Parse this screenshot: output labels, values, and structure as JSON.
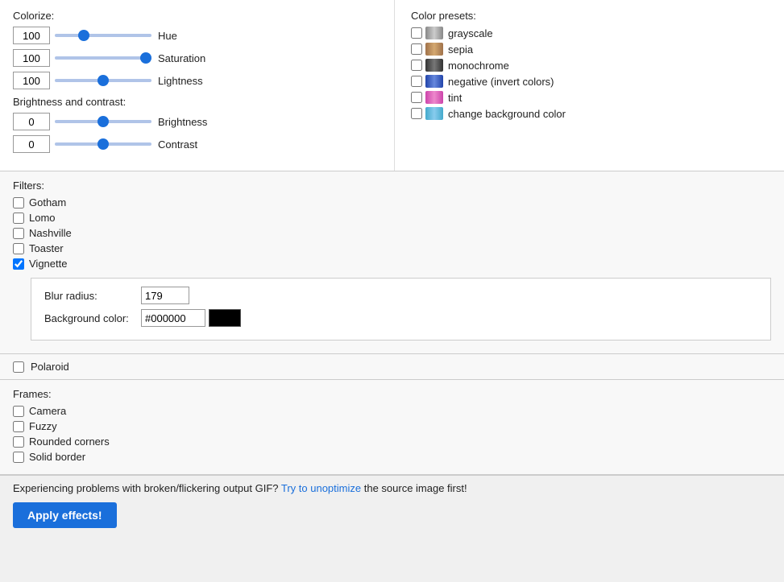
{
  "colorize": {
    "label": "Colorize:",
    "hue": {
      "label": "Hue",
      "value": "100",
      "min": 0,
      "max": 360,
      "current": 100
    },
    "saturation": {
      "label": "Saturation",
      "value": "100",
      "min": 0,
      "max": 100,
      "current": 100
    },
    "lightness": {
      "label": "Lightness",
      "value": "100",
      "min": 0,
      "max": 200,
      "current": 100
    }
  },
  "brightness_contrast": {
    "label": "Brightness and contrast:",
    "brightness": {
      "label": "Brightness",
      "value": "0",
      "min": -100,
      "max": 100,
      "current": 0
    },
    "contrast": {
      "label": "Contrast",
      "value": "0",
      "min": -100,
      "max": 100,
      "current": 0
    }
  },
  "color_presets": {
    "label": "Color presets:",
    "items": [
      {
        "id": "grayscale",
        "label": "grayscale",
        "checked": false,
        "icon_color": "#888"
      },
      {
        "id": "sepia",
        "label": "sepia",
        "checked": false,
        "icon_color": "#a0724a"
      },
      {
        "id": "monochrome",
        "label": "monochrome",
        "checked": false,
        "icon_color": "#555"
      },
      {
        "id": "negative",
        "label": "negative (invert colors)",
        "checked": false,
        "icon_color": "#2244aa"
      },
      {
        "id": "tint",
        "label": "tint",
        "checked": false,
        "icon_color": "#dd66aa"
      },
      {
        "id": "change_bg",
        "label": "change background color",
        "checked": false,
        "icon_color": "#44aacc"
      }
    ]
  },
  "filters": {
    "label": "Filters:",
    "items": [
      {
        "id": "gotham",
        "label": "Gotham",
        "checked": false
      },
      {
        "id": "lomo",
        "label": "Lomo",
        "checked": false
      },
      {
        "id": "nashville",
        "label": "Nashville",
        "checked": false
      },
      {
        "id": "toaster",
        "label": "Toaster",
        "checked": false
      },
      {
        "id": "vignette",
        "label": "Vignette",
        "checked": true
      }
    ]
  },
  "vignette": {
    "blur_radius_label": "Blur radius:",
    "blur_radius_value": "179",
    "background_color_label": "Background color:",
    "background_color_value": "#000000",
    "swatch_color": "#000000"
  },
  "polaroid": {
    "label": "Polaroid",
    "checked": false
  },
  "frames": {
    "label": "Frames:",
    "items": [
      {
        "id": "camera",
        "label": "Camera",
        "checked": false
      },
      {
        "id": "fuzzy",
        "label": "Fuzzy",
        "checked": false
      },
      {
        "id": "rounded_corners",
        "label": "Rounded corners",
        "checked": false
      },
      {
        "id": "solid_border",
        "label": "Solid border",
        "checked": false
      }
    ]
  },
  "bottom": {
    "problem_text_prefix": "Experiencing problems with broken/flickering output GIF? ",
    "problem_link_text": "Try to unoptimize",
    "problem_text_suffix": " the source image first!",
    "apply_button_label": "Apply effects!"
  }
}
